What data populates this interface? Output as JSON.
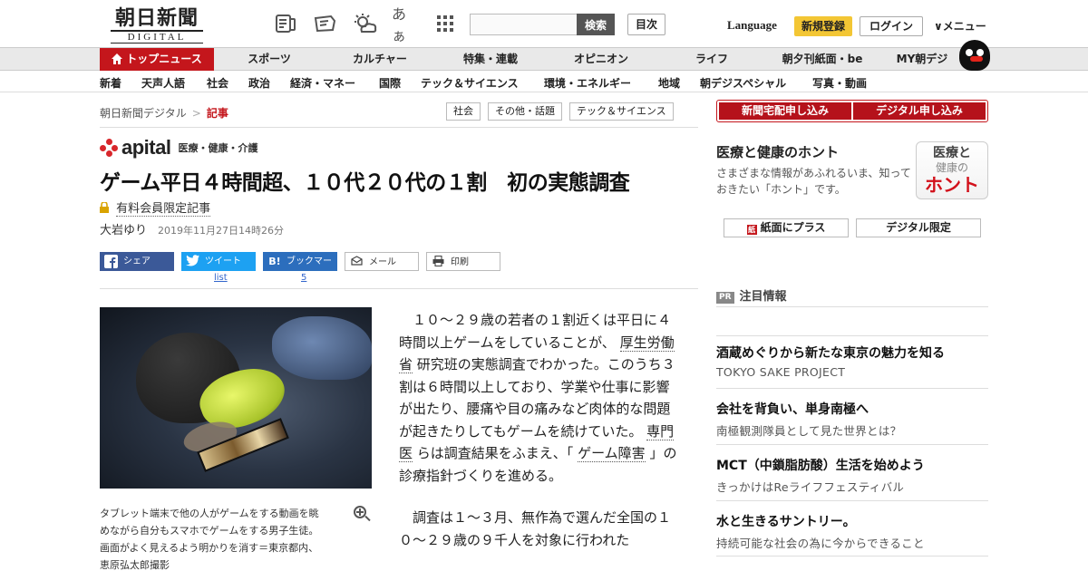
{
  "header": {
    "logo_jp": "朝日新聞",
    "logo_en": "DIGITAL",
    "search_button": "検索",
    "search_placeholder": "",
    "toc_button": "目次",
    "language": "Language",
    "register": "新規登録",
    "login": "ログイン",
    "menu": "∨メニュー",
    "kana_icon": "あぁ"
  },
  "nav_main": [
    {
      "label": "トップニュース",
      "active": true
    },
    {
      "label": "スポーツ"
    },
    {
      "label": "カルチャー"
    },
    {
      "label": "特集・連載"
    },
    {
      "label": "オピニオン"
    },
    {
      "label": "ライフ"
    },
    {
      "label": "朝夕刊紙面・be"
    },
    {
      "label": "MY朝デジ"
    }
  ],
  "nav_sub": [
    "新着",
    "天声人語",
    "社会",
    "政治",
    "経済・マネー",
    "国際",
    "テック＆サイエンス",
    "環境・エネルギー",
    "地域",
    "朝デジスペシャル",
    "写真・動画"
  ],
  "breadcrumb": {
    "home": "朝日新聞デジタル",
    "sep": ">",
    "current": "記事"
  },
  "tags": [
    "社会",
    "その他・話題",
    "テック＆サイエンス"
  ],
  "apital": {
    "word": "apital",
    "category": "医療・健康・介護"
  },
  "article": {
    "title": "ゲーム平日４時間超、１０代２０代の１割　初の実態調査",
    "paid_label": "有料会員限定記事",
    "author": "大岩ゆり",
    "date": "2019年11月27日14時26分"
  },
  "share": {
    "facebook": "シェア",
    "twitter": "ツイート",
    "hatena": "ブックマーク",
    "hatena_icon": "B!",
    "mail": "メール",
    "print": "印刷",
    "twitter_count": "list",
    "hatena_count": "5"
  },
  "photo": {
    "caption_lines": [
      "タブレット端末で他の人がゲームをする動画を眺",
      "めながら自分もスマホでゲームをする男子生徒。",
      "画面がよく見えるよう明かりを消す＝東京都内、",
      "恵原弘太郎撮影"
    ]
  },
  "body": {
    "p1_a": "１０～２９歳の若者の１割近くは平日に４時間以上ゲームをしていることが、",
    "p1_link1": "厚生労働省",
    "p1_b": "研究班の実態調査でわかった。このうち３割は６時間以上しており、学業や仕事に影響が出たり、腰痛や目の痛みなど肉体的な問題が起きたりしてもゲームを続けていた。",
    "p1_link2": "専門医",
    "p1_c": "らは調査結果をふまえ、「",
    "p1_link3": "ゲーム障害",
    "p1_d": "」の診療指針づくりを進める。",
    "p2": "調査は１～３月、無作為で選んだ全国の１０～２９歳の９千人を対象に行われた"
  },
  "sidebar": {
    "apply_home": "新聞宅配申し込み",
    "apply_digital": "デジタル申し込み",
    "honto_heading": "医療と健康のホント",
    "honto_desc": "さまざまな情報があふれるいま、知っておきたい「ホント」です。",
    "honto_logo_1": "医療と",
    "honto_logo_2": "健康の",
    "honto_logo_3": "ホント",
    "paper_plus": "紙面にプラス",
    "paper_plus_icon": "紙",
    "digital_only": "デジタル限定",
    "pr_badge": "PR",
    "pr_heading": "注目情報",
    "items": [
      {
        "title": "酒蔵めぐりから新たな東京の魅力を知る",
        "sub": "TOKYO SAKE PROJECT"
      },
      {
        "title": "会社を背負い、単身南極へ",
        "sub": "南極観測隊員として見た世界とは？"
      },
      {
        "title": "MCT（中鎖脂肪酸）生活を始めよう",
        "sub": "きっかけはReライフフェスティバル"
      },
      {
        "title": "水と生きるサントリー。",
        "sub": "持続可能な社会の為に今からできること"
      }
    ]
  }
}
